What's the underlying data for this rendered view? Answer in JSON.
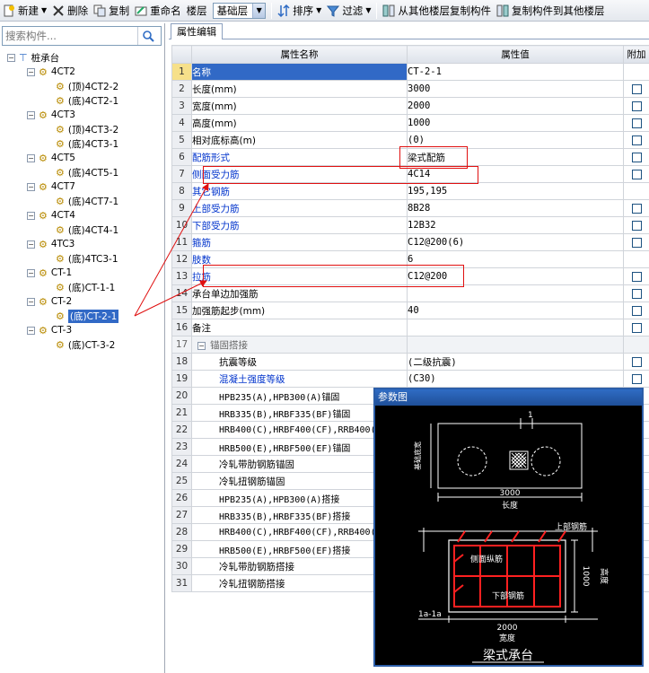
{
  "toolbar": {
    "new_label": "新建",
    "delete_label": "删除",
    "copy_label": "复制",
    "rename_label": "重命名",
    "floor_label": "楼层",
    "floor_value": "基础层",
    "sort_label": "排序",
    "filter_label": "过滤",
    "copy_from_other_label": "从其他楼层复制构件",
    "copy_to_other_label": "复制构件到其他楼层"
  },
  "search": {
    "placeholder": "搜索构件..."
  },
  "tree": {
    "root": "桩承台",
    "groups": [
      {
        "name": "4CT2",
        "children": [
          "(顶)4CT2-2",
          "(底)4CT2-1"
        ]
      },
      {
        "name": "4CT3",
        "children": [
          "(顶)4CT3-2",
          "(底)4CT3-1"
        ]
      },
      {
        "name": "4CT5",
        "children": [
          "(底)4CT5-1"
        ]
      },
      {
        "name": "4CT7",
        "children": [
          "(底)4CT7-1"
        ]
      },
      {
        "name": "4CT4",
        "children": [
          "(底)4CT4-1"
        ]
      },
      {
        "name": "4TC3",
        "children": [
          "(底)4TC3-1"
        ]
      },
      {
        "name": "CT-1",
        "children": [
          "(底)CT-1-1"
        ]
      },
      {
        "name": "CT-2",
        "children": [
          "(底)CT-2-1"
        ]
      },
      {
        "name": "CT-3",
        "children": [
          "(底)CT-3-2"
        ]
      }
    ],
    "selected": "(底)CT-2-1"
  },
  "tab": {
    "label": "属性编辑"
  },
  "grid": {
    "headers": {
      "name": "属性名称",
      "value": "属性值",
      "extra": "附加"
    },
    "rows": [
      {
        "n": "1",
        "name": "名称",
        "value": "CT-2-1",
        "blue": true,
        "chk": false,
        "cur": true
      },
      {
        "n": "2",
        "name": "长度(mm)",
        "value": "3000",
        "chk": true
      },
      {
        "n": "3",
        "name": "宽度(mm)",
        "value": "2000",
        "chk": true
      },
      {
        "n": "4",
        "name": "高度(mm)",
        "value": "1000",
        "chk": true
      },
      {
        "n": "5",
        "name": "相对底标高(m)",
        "value": "(0)",
        "chk": true
      },
      {
        "n": "6",
        "name": "配筋形式",
        "value": "梁式配筋",
        "blue": true,
        "chk": true
      },
      {
        "n": "7",
        "name": "侧面受力筋",
        "value": "4C14",
        "blue": true,
        "chk": true
      },
      {
        "n": "8",
        "name": "其它钢筋",
        "value": "195,195",
        "blue": true,
        "chk": false
      },
      {
        "n": "9",
        "name": "上部受力筋",
        "value": "8B28",
        "blue": true,
        "chk": true
      },
      {
        "n": "10",
        "name": "下部受力筋",
        "value": "12B32",
        "blue": true,
        "chk": true
      },
      {
        "n": "11",
        "name": "箍筋",
        "value": "C12@200(6)",
        "blue": true,
        "chk": true
      },
      {
        "n": "12",
        "name": "肢数",
        "value": "6",
        "blue": true,
        "chk": false
      },
      {
        "n": "13",
        "name": "拉筋",
        "value": "C12@200",
        "blue": true,
        "chk": true
      },
      {
        "n": "14",
        "name": "承台单边加强筋",
        "value": "",
        "chk": true
      },
      {
        "n": "15",
        "name": "加强筋起步(mm)",
        "value": "40",
        "chk": true
      },
      {
        "n": "16",
        "name": "备注",
        "value": "",
        "chk": true
      },
      {
        "n": "17",
        "name": "锚固搭接",
        "value": "",
        "group": true,
        "chk": false
      },
      {
        "n": "18",
        "name": "抗震等级",
        "value": "(二级抗震)",
        "sub": true,
        "chk": true
      },
      {
        "n": "19",
        "name": "混凝土强度等级",
        "value": "(C30)",
        "sub": true,
        "blue": true,
        "chk": true
      },
      {
        "n": "20",
        "name": "HPB235(A),HPB300(A)锚固",
        "value": "",
        "sub": true,
        "mono": true,
        "chk": false
      },
      {
        "n": "21",
        "name": "HRB335(B),HRBF335(BF)锚固",
        "value": "",
        "sub": true,
        "mono": true,
        "chk": false
      },
      {
        "n": "22",
        "name": "HRB400(C),HRBF400(CF),RRB400(",
        "value": "",
        "sub": true,
        "mono": true,
        "chk": false
      },
      {
        "n": "23",
        "name": "HRB500(E),HRBF500(EF)锚固",
        "value": "",
        "sub": true,
        "mono": true,
        "chk": false
      },
      {
        "n": "24",
        "name": "冷轧带肋钢筋锚固",
        "value": "",
        "sub": true,
        "chk": false
      },
      {
        "n": "25",
        "name": "冷轧扭钢筋锚固",
        "value": "",
        "sub": true,
        "chk": false
      },
      {
        "n": "26",
        "name": "HPB235(A),HPB300(A)搭接",
        "value": "",
        "sub": true,
        "mono": true,
        "chk": false
      },
      {
        "n": "27",
        "name": "HRB335(B),HRBF335(BF)搭接",
        "value": "",
        "sub": true,
        "mono": true,
        "chk": false
      },
      {
        "n": "28",
        "name": "HRB400(C),HRBF400(CF),RRB400(",
        "value": "",
        "sub": true,
        "mono": true,
        "chk": false
      },
      {
        "n": "29",
        "name": "HRB500(E),HRBF500(EF)搭接",
        "value": "",
        "sub": true,
        "mono": true,
        "chk": false
      },
      {
        "n": "30",
        "name": "冷轧带肋钢筋搭接",
        "value": "",
        "sub": true,
        "chk": false
      },
      {
        "n": "31",
        "name": "冷轧扭钢筋搭接",
        "value": "",
        "sub": true,
        "chk": false
      }
    ]
  },
  "diagram": {
    "title": "参数图",
    "plan_top_label": "1",
    "plan_width_label": "基础底宽",
    "length_value": "3000",
    "length_label": "长度",
    "top_bar_label": "上部钢筋",
    "side_bar_label": "侧面纵筋",
    "bottom_bar_label": "下部钢筋",
    "height_value": "1000",
    "height_label": "高度",
    "section_label": "1a-1a",
    "width_value": "2000",
    "width_label": "宽度",
    "caption": "梁式承台",
    "colors": {
      "bg": "#000000",
      "line": "#ffffff",
      "rebar": "#ff2020",
      "title_bar": "#2f6cc4"
    }
  },
  "colors": {
    "annotation": "#e01010",
    "selection": "#3169c6",
    "link_text": "#0033cc"
  }
}
